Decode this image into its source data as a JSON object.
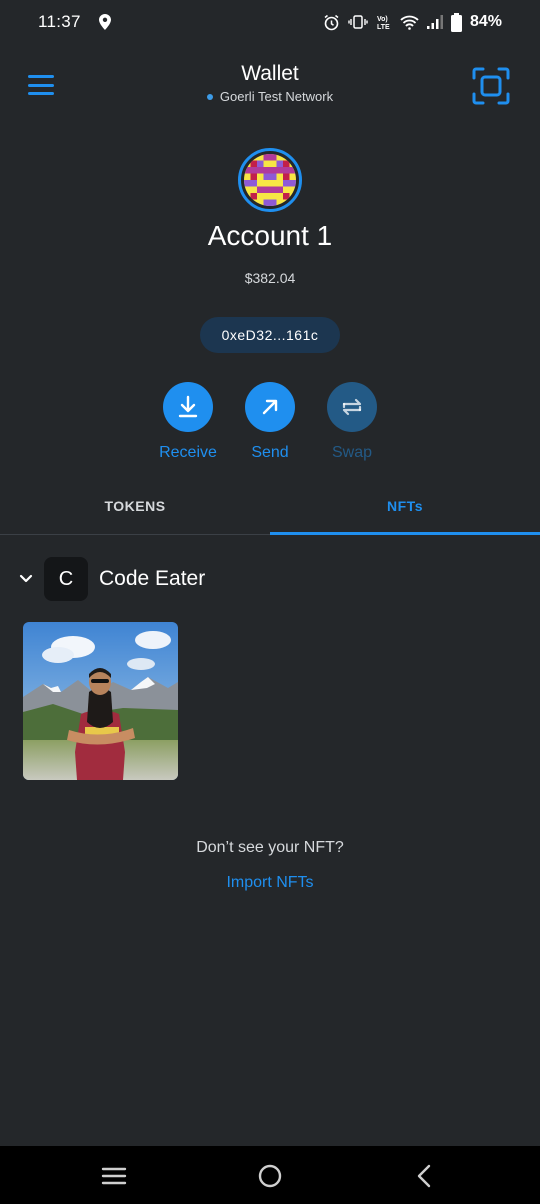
{
  "status_bar": {
    "time": "11:37",
    "battery": "84%",
    "volte": "Vo)\nLTE"
  },
  "header": {
    "title": "Wallet",
    "network": "Goerli Test Network"
  },
  "account": {
    "name": "Account 1",
    "balance": "$382.04",
    "address": "0xeD32...161c"
  },
  "actions": [
    {
      "label": "Receive",
      "icon": "download-icon",
      "enabled": true
    },
    {
      "label": "Send",
      "icon": "arrow-up-right-icon",
      "enabled": true
    },
    {
      "label": "Swap",
      "icon": "swap-icon",
      "enabled": false
    }
  ],
  "tabs": [
    {
      "label": "TOKENS",
      "active": false
    },
    {
      "label": "NFTs",
      "active": true
    }
  ],
  "collection": {
    "initial": "C",
    "name": "Code Eater"
  },
  "empty_state": {
    "question": "Don’t see your NFT?",
    "import_label": "Import NFTs"
  },
  "colors": {
    "background": "#24272a",
    "accent": "#1f8fef",
    "accent_disabled": "#235a86",
    "pill": "#1c3650",
    "nav_bar": "#000000"
  }
}
